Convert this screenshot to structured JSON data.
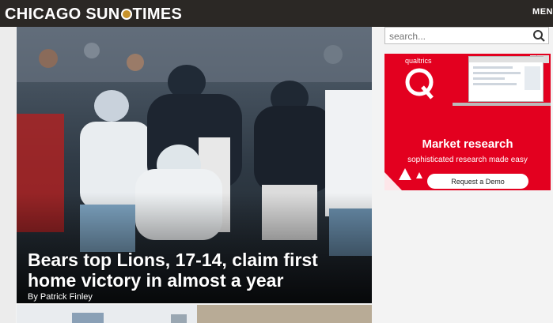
{
  "header": {
    "logo_left": "CHICAGO SUN",
    "logo_right": "TIMES",
    "menu_label": "MEN"
  },
  "hero": {
    "headline": "Bears top Lions, 17-14, claim first home victory in almost a year",
    "byline": "By Patrick Finley"
  },
  "search": {
    "placeholder": "search..."
  },
  "ad": {
    "brand": "qualtrics",
    "headline": "Market research",
    "subline": "sophisticated research made easy",
    "cta": "Request a Demo"
  },
  "colors": {
    "topbar": "#2b2825",
    "ad_red": "#e3001f"
  }
}
